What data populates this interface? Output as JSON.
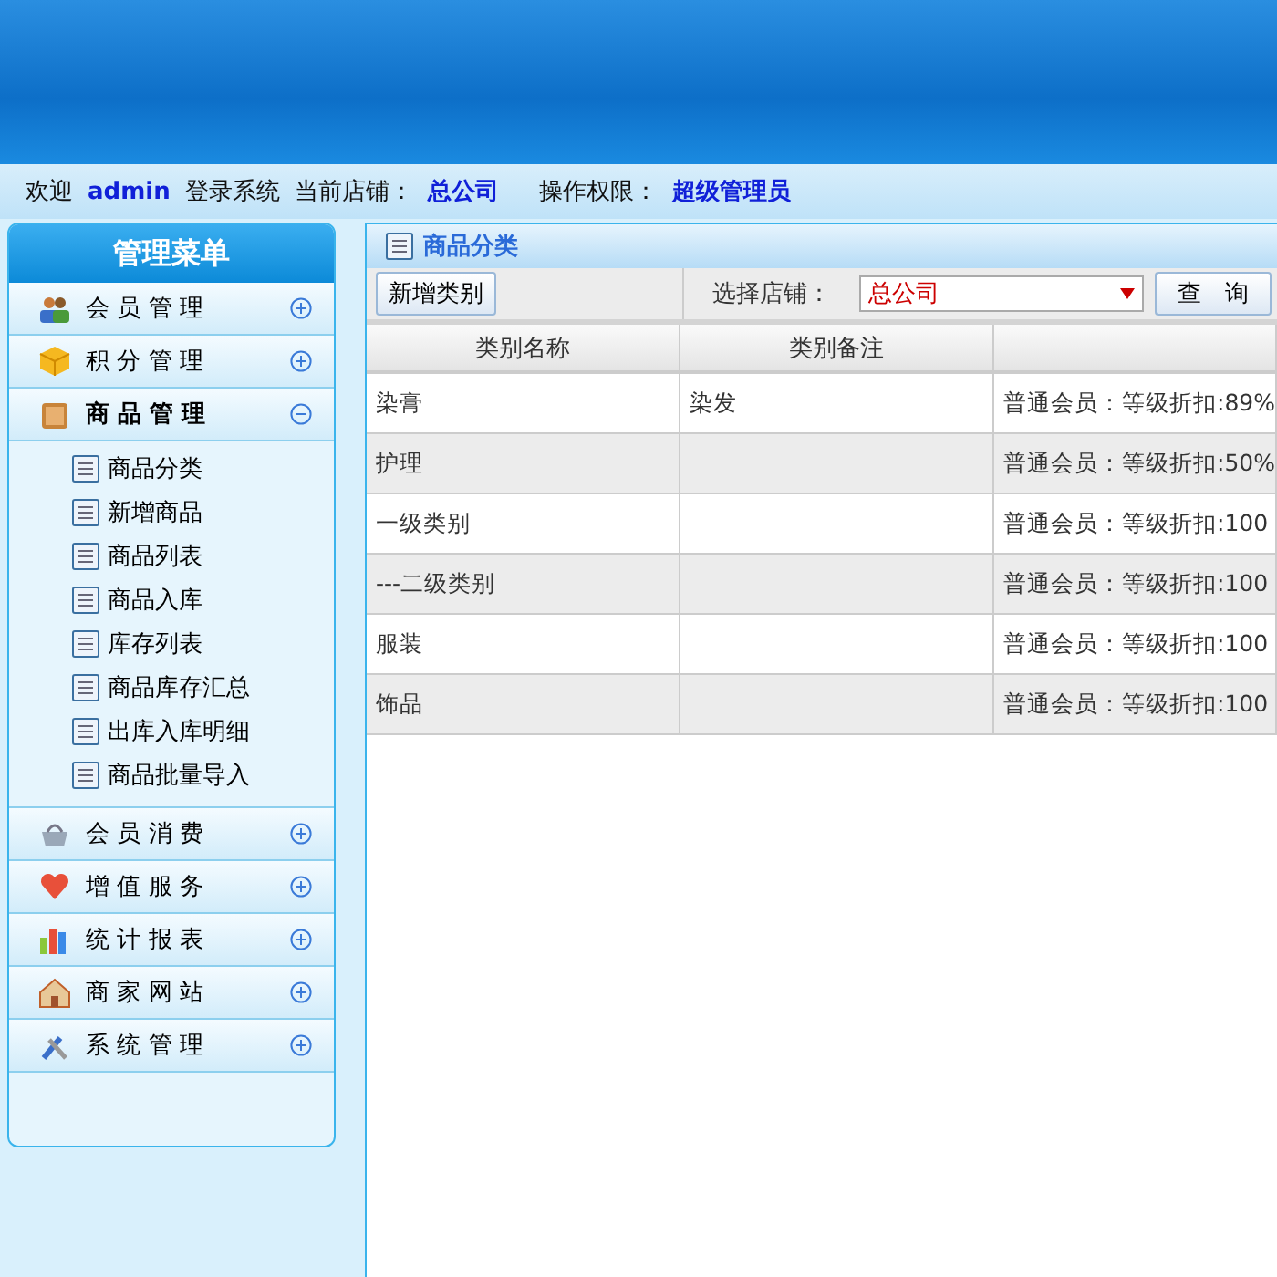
{
  "info_bar": {
    "welcome": "欢迎",
    "user": "admin",
    "login_text": "登录系统",
    "store_label": "当前店铺：",
    "store": "总公司",
    "permission_label": "操作权限：",
    "permission": "超级管理员"
  },
  "sidebar": {
    "title": "管理菜单",
    "groups": [
      {
        "label": "会 员 管 理",
        "expanded": false
      },
      {
        "label": "积 分 管 理",
        "expanded": false
      },
      {
        "label": "商 品 管 理",
        "expanded": true,
        "children": [
          {
            "label": "商品分类"
          },
          {
            "label": "新增商品"
          },
          {
            "label": "商品列表"
          },
          {
            "label": "商品入库"
          },
          {
            "label": "库存列表"
          },
          {
            "label": "商品库存汇总"
          },
          {
            "label": "出库入库明细"
          },
          {
            "label": "商品批量导入"
          }
        ]
      },
      {
        "label": "会 员 消 费",
        "expanded": false
      },
      {
        "label": "增 值 服 务",
        "expanded": false
      },
      {
        "label": "统 计 报 表",
        "expanded": false
      },
      {
        "label": "商 家 网 站",
        "expanded": false
      },
      {
        "label": "系 统 管 理",
        "expanded": false
      }
    ]
  },
  "panel": {
    "title": "商品分类",
    "add_button": "新增类别",
    "store_label": "选择店铺：",
    "store_select": "总公司",
    "query_button": "查　询",
    "table": {
      "columns": [
        "类别名称",
        "类别备注"
      ],
      "rows": [
        {
          "name": "染膏",
          "note": "染发",
          "discount": "普通会员：等级折扣:89%"
        },
        {
          "name": "护理",
          "note": "",
          "discount": "普通会员：等级折扣:50%"
        },
        {
          "name": "一级类别",
          "note": "",
          "discount": "普通会员：等级折扣:100"
        },
        {
          "name": "---二级类别",
          "note": "",
          "discount": "普通会员：等级折扣:100"
        },
        {
          "name": "服装",
          "note": "",
          "discount": "普通会员：等级折扣:100"
        },
        {
          "name": "饰品",
          "note": "",
          "discount": "普通会员：等级折扣:100"
        }
      ]
    }
  }
}
